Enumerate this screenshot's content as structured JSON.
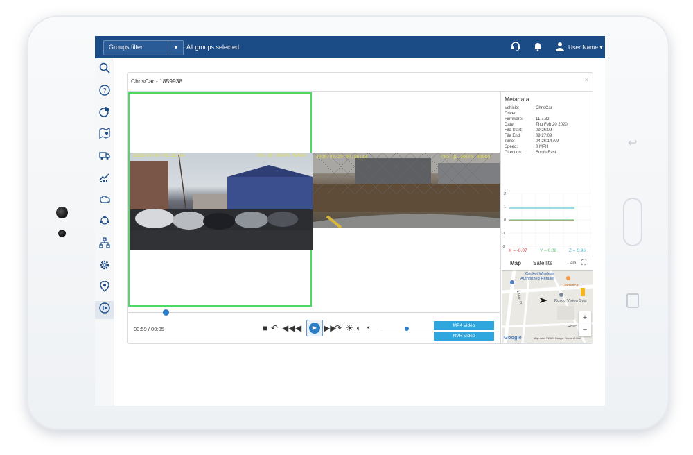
{
  "topbar": {
    "groups_filter_label": "Groups filter",
    "groups_status": "All groups selected",
    "user_name": "User Name"
  },
  "icons": {
    "support": "headset-icon",
    "notifications": "bell-icon",
    "user": "user-icon"
  },
  "sidebar": {
    "items": [
      "search-icon",
      "help-icon",
      "pie-chart-icon",
      "map-pin-icon",
      "truck-icon",
      "trend-icon",
      "engine-icon",
      "nodes-icon",
      "org-chart-icon",
      "gear-icon",
      "location-badge-icon",
      "playback-icon"
    ],
    "active": "playback-icon"
  },
  "panel": {
    "title": "ChrisCar - 1859938",
    "close": "×"
  },
  "video": {
    "cam1_osd_left": "2020/02/20 09:26:14",
    "cam1_osd_right": "CH1 Q5 20FPS ROSCO",
    "cam2_osd_left": "2020/02/20 09:26:14",
    "cam2_osd_right": "CH3 Q5 20FPS ROSCO"
  },
  "metadata": {
    "title": "Metadata",
    "rows": [
      {
        "key": "Vehicle:",
        "value": "ChrisCar"
      },
      {
        "key": "Driver:",
        "value": ""
      },
      {
        "key": "Firmware:",
        "value": "11.7.82"
      },
      {
        "key": "Date:",
        "value": "Thu Feb 20 2020"
      },
      {
        "key": "File Start:",
        "value": "09:26:09"
      },
      {
        "key": "File End:",
        "value": "09:27:09"
      },
      {
        "key": "Time:",
        "value": "04:26:14 AM"
      },
      {
        "key": "Speed:",
        "value": "0 MPH"
      },
      {
        "key": "Direction:",
        "value": "South East"
      }
    ],
    "graph": {
      "y_ticks": [
        "2",
        "1",
        "0",
        "-1",
        "-2"
      ],
      "x_readout": "X = -0.07",
      "y_readout": "Y = 0.06",
      "z_readout": "Z = 0.96",
      "colors": {
        "x": "#e0393e",
        "y": "#4cc16a",
        "z": "#3ab5c8"
      }
    }
  },
  "map": {
    "tab_map": "Map",
    "tab_satellite": "Satellite",
    "place1": "Cricket Wireless",
    "place1b": "Authorized Retailer",
    "place2": "Jamaica",
    "place3": "Rosco Vision Syst",
    "street1": "Jam",
    "street2": "144th Pl",
    "street3": "Rosc",
    "zoom_in": "+",
    "zoom_out": "−",
    "google": "Google",
    "attribution": "Map data ©2020 Google   Terms of Use"
  },
  "controls": {
    "time": "00:59 / 00:05",
    "progress": 0.1,
    "volume": 0.5,
    "mp4_button": "MP4 Video",
    "nvr_button": "NVR Video"
  }
}
